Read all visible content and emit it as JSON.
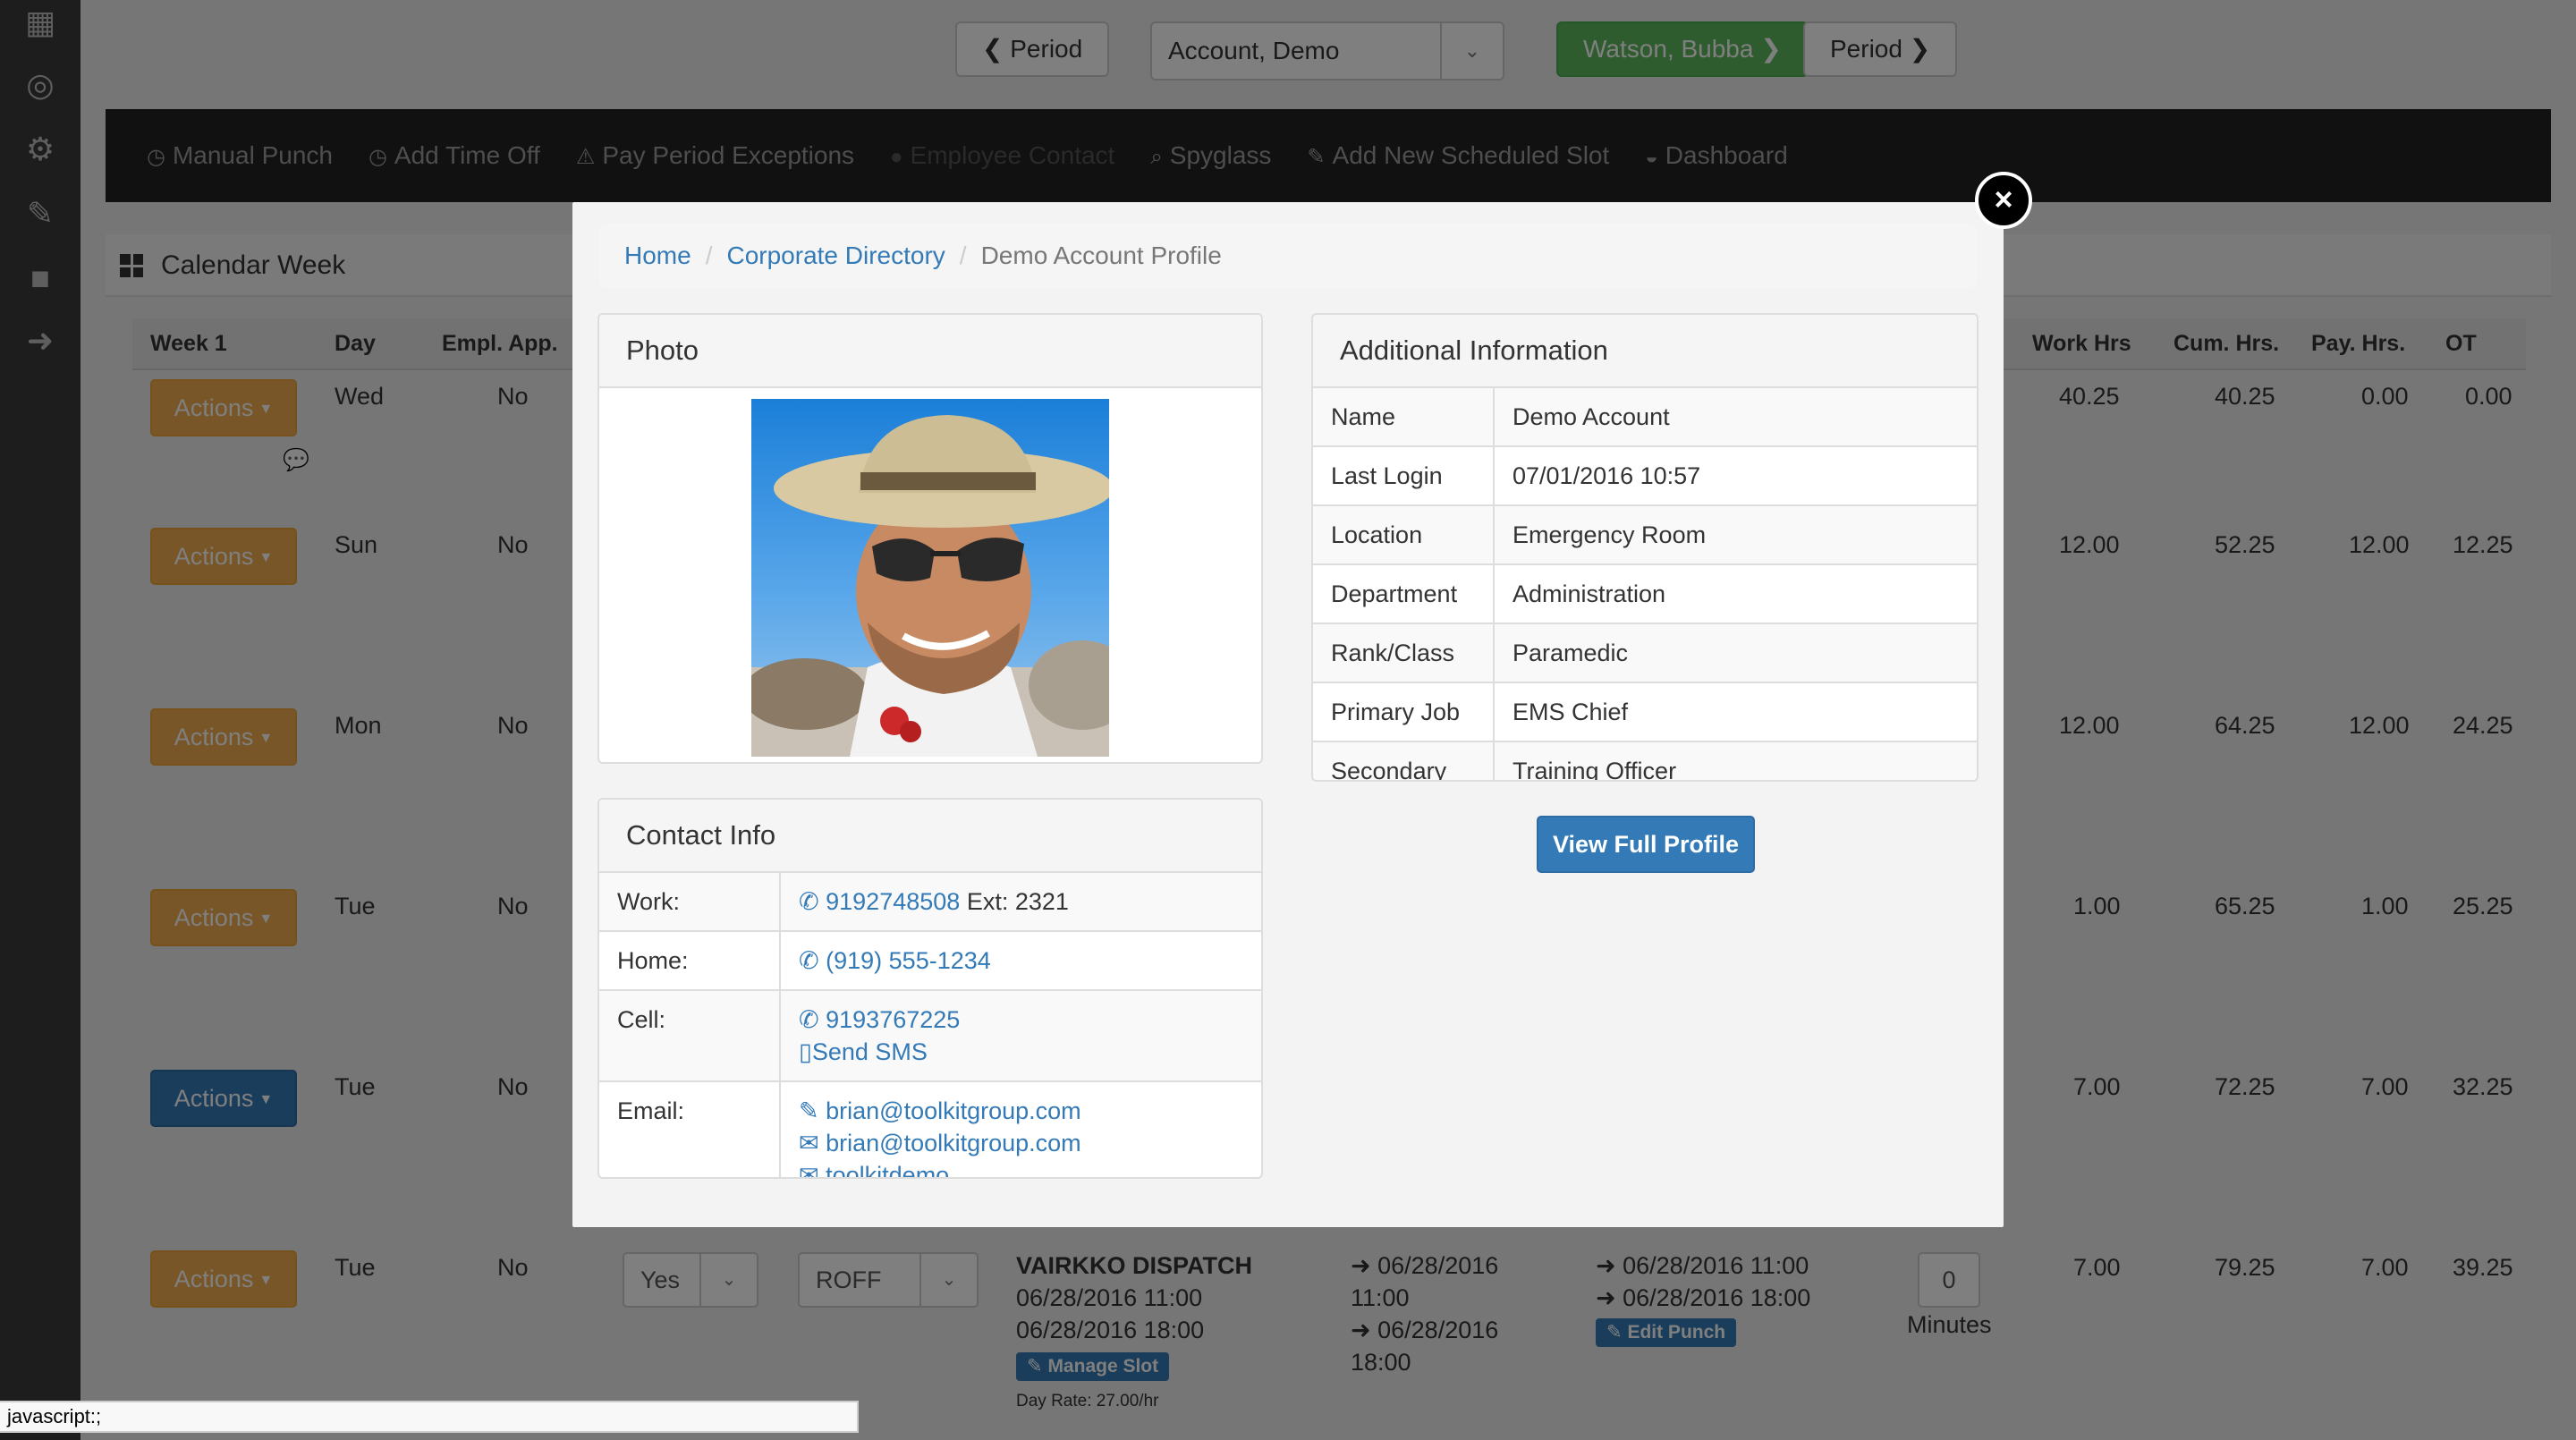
{
  "topbar": {
    "prev_period": "Period",
    "account_select": "Account, Demo",
    "employee_button": "Watson, Bubba",
    "next_period": "Period"
  },
  "navbar": {
    "items": [
      "Manual Punch",
      "Add Time Off",
      "Pay Period Exceptions",
      "Employee Contact",
      "Spyglass",
      "Add New Scheduled Slot",
      "Dashboard"
    ]
  },
  "calendar": {
    "title": "Calendar Week",
    "headers": {
      "week": "Week 1",
      "day": "Day",
      "empl_app": "Empl. App.",
      "work_hrs": "Work Hrs",
      "cum_hrs": "Cum. Hrs.",
      "pay_hrs": "Pay. Hrs.",
      "ot": "OT"
    },
    "actions_label": "Actions",
    "rows": [
      {
        "day": "Wed",
        "app": "No",
        "work": "40.25",
        "cum": "40.25",
        "pay": "0.00",
        "ot": "0.00"
      },
      {
        "day": "Sun",
        "app": "No",
        "work": "12.00",
        "cum": "52.25",
        "pay": "12.00",
        "ot": "12.25"
      },
      {
        "day": "Mon",
        "app": "No",
        "work": "12.00",
        "cum": "64.25",
        "pay": "12.00",
        "ot": "24.25"
      },
      {
        "day": "Tue",
        "app": "No",
        "work": "1.00",
        "cum": "65.25",
        "pay": "1.00",
        "ot": "25.25"
      },
      {
        "day": "Tue",
        "app": "No",
        "work": "7.00",
        "cum": "72.25",
        "pay": "7.00",
        "ot": "32.25"
      },
      {
        "day": "Tue",
        "app": "No",
        "work": "7.00",
        "cum": "79.25",
        "pay": "7.00",
        "ot": "39.25"
      }
    ],
    "last_row": {
      "approve": "Yes",
      "code": "ROFF",
      "slot_name": "VAIRKKO DISPATCH",
      "slot_start": "06/28/2016 11:00",
      "slot_end": "06/28/2016 18:00",
      "manage_slot": "Manage Slot",
      "day_rate": "Day Rate: 27.00/hr",
      "punch_in_date": "06/28/2016",
      "punch_in_time": "11:00",
      "punch_out_date": "06/28/2016",
      "punch_out_time": "18:00",
      "sched_in": "06/28/2016 11:00",
      "sched_out": "06/28/2016 18:00",
      "edit_punch": "Edit Punch",
      "minutes_value": "0",
      "minutes_label": "Minutes"
    }
  },
  "status_bar": "javascript:;",
  "modal": {
    "close": "×",
    "breadcrumb": {
      "home": "Home",
      "directory": "Corporate Directory",
      "current": "Demo Account Profile"
    },
    "photo_title": "Photo",
    "additional": {
      "title": "Additional Information",
      "rows": [
        {
          "k": "Name",
          "v": "Demo Account"
        },
        {
          "k": "Last Login",
          "v": "07/01/2016 10:57"
        },
        {
          "k": "Location",
          "v": "Emergency Room"
        },
        {
          "k": "Department",
          "v": "Administration"
        },
        {
          "k": "Rank/Class",
          "v": "Paramedic"
        },
        {
          "k": "Primary Job",
          "v": "EMS Chief"
        },
        {
          "k": "Secondary Job",
          "v": "Training Officer"
        }
      ]
    },
    "view_full_profile": "View Full Profile",
    "contact": {
      "title": "Contact Info",
      "work_label": "Work:",
      "work_phone": "9192748508",
      "work_ext": "Ext: 2321",
      "home_label": "Home:",
      "home_phone": "(919) 555-1234",
      "cell_label": "Cell:",
      "cell_phone": "9193767225",
      "send_sms": "Send SMS",
      "email_label": "Email:",
      "email_1": "brian@toolkitgroup.com",
      "email_2": "brian@toolkitgroup.com",
      "email_3": "toolkitdemo"
    }
  }
}
